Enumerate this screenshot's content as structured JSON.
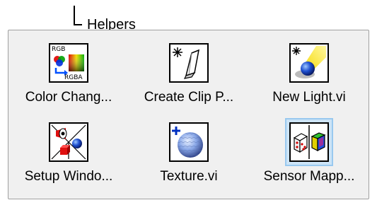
{
  "tree": {
    "label": "Helpers"
  },
  "palette": {
    "items": [
      {
        "label": "Color Chang...",
        "icon": "color-change-rgb-rgba-icon",
        "icon_text_top": "RGB",
        "icon_text_bottom": "RGBA",
        "selected": false
      },
      {
        "label": "Create Clip P...",
        "icon": "create-clip-plane-icon",
        "selected": false
      },
      {
        "label": "New Light.vi",
        "icon": "new-light-icon",
        "selected": false
      },
      {
        "label": "Setup Windo...",
        "icon": "setup-window-icon",
        "selected": false
      },
      {
        "label": "Texture.vi",
        "icon": "texture-icon",
        "selected": false
      },
      {
        "label": "Sensor Mapp...",
        "icon": "sensor-mapping-icon",
        "selected": true
      }
    ]
  },
  "colors": {
    "selection_fill": "#cce4f7",
    "selection_border": "#99c9ef",
    "palette_background": "#f0f0f0",
    "sphere_blue": "#1e4fd0",
    "light_yellow": "#f5d800"
  }
}
